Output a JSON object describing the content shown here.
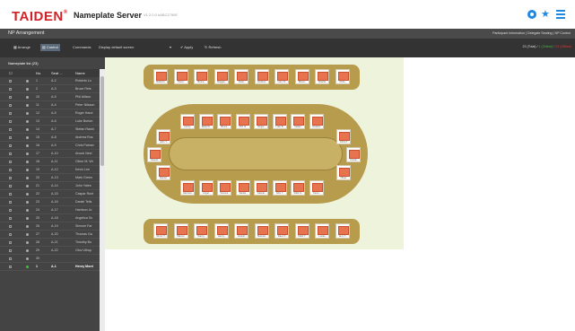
{
  "header": {
    "brand": "TAIDEN",
    "brand_mark": "®",
    "product": "Nameplate Server",
    "version": "V1.2.0.0 #ABC1790E"
  },
  "titlebar": {
    "title": "NP Arrangement",
    "links": "Participant Information | Delegate Seating | NP Control"
  },
  "toolbar": {
    "arrange": "Arrange",
    "control": "Control",
    "commands_label": "Commands",
    "commands_value": "Display default screen",
    "apply": "Apply",
    "refresh": "Refresh",
    "status_prefix": "23 (Total) /",
    "status_online": "1 (Online) /",
    "status_offline": "22 (Offline)"
  },
  "sidebar": {
    "title": "Nameplate list (23)",
    "columns": [
      "No.",
      "Seat ...",
      "Name"
    ],
    "rows": [
      {
        "no": "1",
        "seat": "A-2",
        "name": "Roberto Lo"
      },
      {
        "no": "2",
        "seat": "A-3",
        "name": "Bruce Rels"
      },
      {
        "no": "10",
        "seat": "A-5",
        "name": "Phil Allison"
      },
      {
        "no": "11",
        "seat": "A-4",
        "name": "Peter Nilsson"
      },
      {
        "no": "12",
        "seat": "A-5",
        "name": "Roger Hand"
      },
      {
        "no": "13",
        "seat": "A-6",
        "name": "Luke Burton"
      },
      {
        "no": "14",
        "seat": "A-7",
        "name": "Stefan Rashi"
      },
      {
        "no": "15",
        "seat": "A-8",
        "name": "Andrew Ros"
      },
      {
        "no": "16",
        "seat": "A-9",
        "name": "Chris Palmer"
      },
      {
        "no": "17",
        "seat": "A-10",
        "name": "Anouk Nesi"
      },
      {
        "no": "18",
        "seat": "A-11",
        "name": "Oliver M. Wr"
      },
      {
        "no": "19",
        "seat": "A-12",
        "name": "Kevin Lee"
      },
      {
        "no": "20",
        "seat": "A-13",
        "name": "Mark Green"
      },
      {
        "no": "21",
        "seat": "A-14",
        "name": "John Yates"
      },
      {
        "no": "22",
        "seat": "A-15",
        "name": "Caspar Runt"
      },
      {
        "no": "23",
        "seat": "A-16",
        "name": "Daniel Tells"
      },
      {
        "no": "24",
        "seat": "A-17",
        "name": "Harrison Jo"
      },
      {
        "no": "25",
        "seat": "A-18",
        "name": "Angelica So"
      },
      {
        "no": "26",
        "seat": "A-19",
        "name": "Simone Far"
      },
      {
        "no": "27",
        "seat": "A-20",
        "name": "Thomas Ga"
      },
      {
        "no": "28",
        "seat": "A-21",
        "name": "Timothy Bo"
      },
      {
        "no": "29",
        "seat": "A-22",
        "name": "Olov Uthup"
      },
      {
        "no": "30",
        "seat": "",
        "name": ""
      },
      {
        "no": "1",
        "seat": "A-1",
        "name": "Henry Mont",
        "online": true,
        "selected": true
      }
    ]
  },
  "seat_labels": {
    "top_bar": [
      "Roberto...",
      "Petra...",
      "Bruce...",
      "Maggie...",
      "Peter...",
      "Andrew...",
      "Larry N...",
      "Bruce...",
      "Charlot...",
      "Chris..."
    ],
    "oval_top": [
      "Henry...",
      "Roberto...",
      "Bruce...",
      "Phil. R...",
      "Roger...",
      "Luke B...",
      "Stefan...",
      "Andrew..."
    ],
    "oval_left": [
      "John Y...",
      "Caspar...",
      "Daniel..."
    ],
    "oval_right": [
      "Chris P...",
      "Anouk...",
      "Oliver..."
    ],
    "oval_bottom": [
      "Harrison...",
      "Angel...",
      "Simone...",
      "Daniel...",
      "Caspar...",
      "John Y...",
      "Mark G...",
      "Kevin..."
    ],
    "bottom_bar": [
      "Simon T...",
      "Marcel...",
      "Nancy...",
      "Henry...",
      "Joseph...",
      "Manuel...",
      "Dave P...",
      "Mark T...",
      "Lucas...",
      "Amy T..."
    ]
  },
  "colors": {
    "brand_red": "#d32227",
    "accent_blue": "#1e88e5",
    "table_gold": "#b79c4e",
    "seat_orange": "#e8744f",
    "canvas_bg": "#eef3dc",
    "online_green": "#3ac13a",
    "offline_red": "#e03a3a"
  }
}
